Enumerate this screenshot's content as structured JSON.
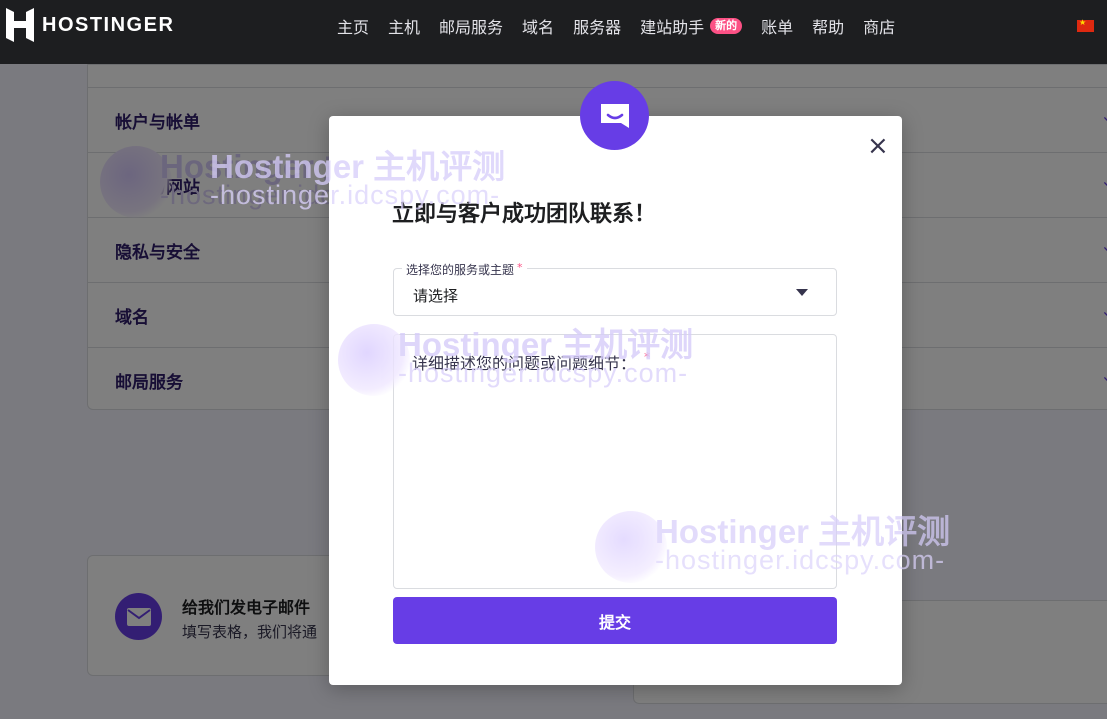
{
  "header": {
    "brand": "HOSTINGER",
    "nav": [
      {
        "label": "主页"
      },
      {
        "label": "主机"
      },
      {
        "label": "邮局服务"
      },
      {
        "label": "域名"
      },
      {
        "label": "服务器"
      },
      {
        "label": "建站助手",
        "badge": "新的"
      },
      {
        "label": "账单"
      },
      {
        "label": "帮助"
      },
      {
        "label": "商店"
      }
    ],
    "flag_icon": "china-flag-icon"
  },
  "faq": {
    "items": [
      {
        "label": "帐户与帐单"
      },
      {
        "label": "主机与网站"
      },
      {
        "label": "隐私与安全"
      },
      {
        "label": "域名"
      },
      {
        "label": "邮局服务"
      }
    ]
  },
  "email_card": {
    "title": "给我们发电子邮件",
    "description": "填写表格，我们将通"
  },
  "watermark": {
    "line1": "Hostinger 主机评测",
    "line2": "-hostinger.idcspy.com-"
  },
  "modal": {
    "title": "立即与客户成功团队联系！",
    "select_legend": "选择您的服务或主题",
    "select_value": "请选择",
    "textarea_placeholder": "详细描述您的问题或问题细节：",
    "required_mark": "*",
    "submit_label": "提交",
    "close_symbol": "×"
  },
  "colors": {
    "brand": "#673de6",
    "header_bg": "#1d1e20",
    "badge": "#fc5185"
  }
}
